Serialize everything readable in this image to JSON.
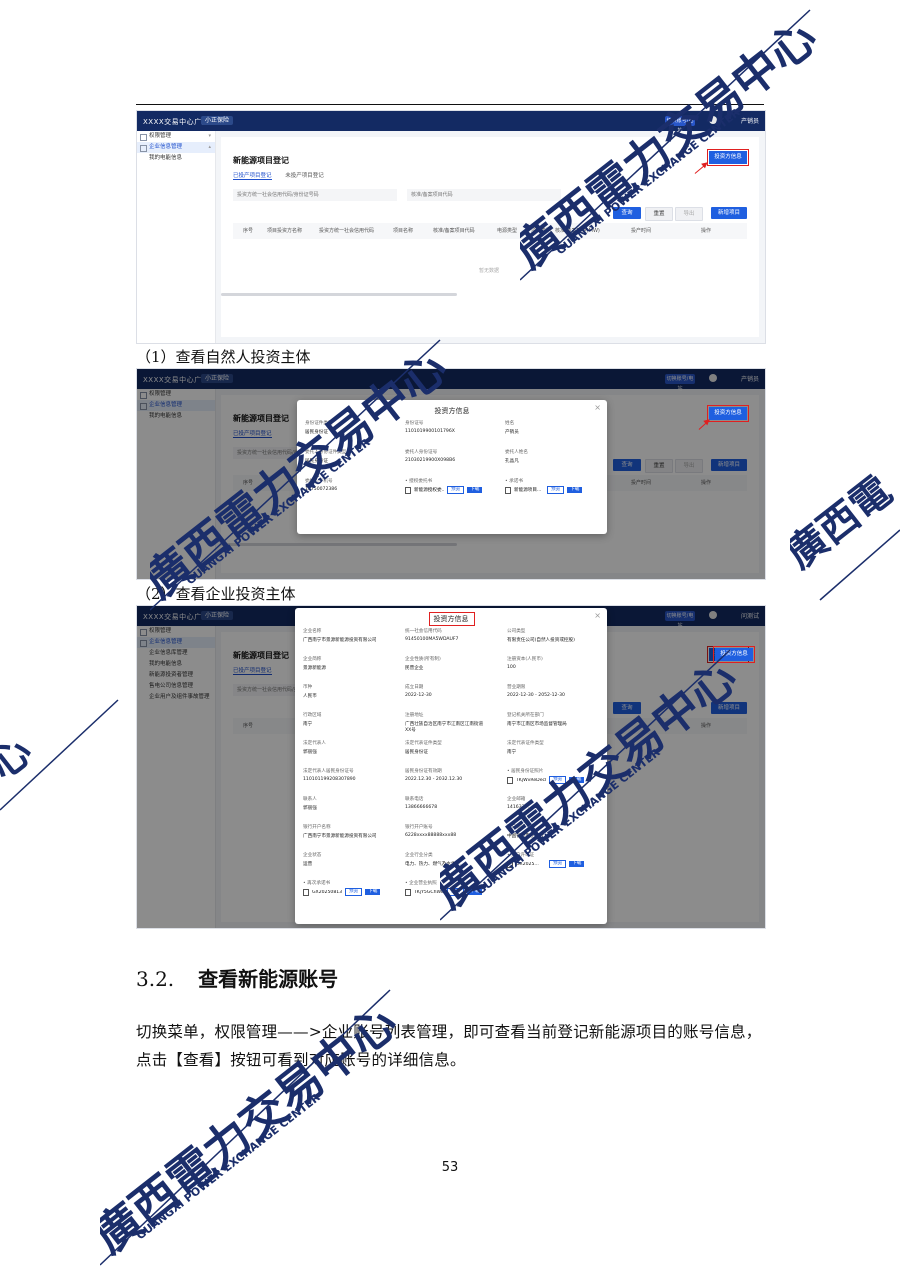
{
  "app": {
    "brand": "XXXX交易中心广西",
    "env_pill": "小正保险",
    "top_button": "切换账号/电站",
    "user": "产销员",
    "user2": "产销员",
    "user3": "问测试"
  },
  "sidebar": {
    "items": [
      "权限管理",
      "企业信息管理",
      "我的电能信息"
    ],
    "items3": [
      "权限管理",
      "企业信息管理",
      "企业信息库管理",
      "我的电能信息",
      "新能源投资者管理",
      "售电公司信息管理",
      "企业用户及组件事故管理"
    ]
  },
  "page": {
    "title": "新能源项目登记",
    "tabs": [
      "已投产项目登记",
      "未投产项目登记"
    ],
    "filter_id": "投资方统一社会信用代码/身份证号码",
    "filter_code": "核准/备案项目代码",
    "btn_query": "查询",
    "btn_reset": "重置",
    "btn_export": "导出",
    "btn_add": "新增项目",
    "btn_info": "投资方信息",
    "columns": [
      "序号",
      "项目投资方名称",
      "投资方统一社会信用代码",
      "项目名称",
      "核准/备案项目代码",
      "电源类型",
      "项目类别",
      "核准/备案容量(MW)",
      "投产时间",
      "操作"
    ],
    "empty": "暂无数据"
  },
  "captions": {
    "natural": "（1）查看自然人投资主体",
    "enterprise": "（2）查看企业投资主体"
  },
  "modal_natural": {
    "title": "投资方信息",
    "fields": [
      {
        "label": "身份证件类型",
        "value": "居民身份证"
      },
      {
        "label": "身份证号",
        "value": "1101019900101796X"
      },
      {
        "label": "姓名",
        "value": "产销员"
      },
      {
        "label": "委托人身份证件类型",
        "value": "居民身份证"
      },
      {
        "label": "委托人身份证号",
        "value": "21030219900X098B6"
      },
      {
        "label": "委托人姓名",
        "value": "孔晶凡"
      },
      {
        "label": "委托人手机号",
        "value": "13750072386"
      },
      {
        "label": "• 授权委托书",
        "value": "新能源授权委..."
      },
      {
        "label": "• 承诺书",
        "value": "新能源项目..."
      }
    ],
    "preview": "预览",
    "download": "下载"
  },
  "modal_enterprise": {
    "title": "投资方信息",
    "fields": [
      {
        "label": "企业名称",
        "value": "广西南宁市景源新能源投资有限公司"
      },
      {
        "label": "统一社会信用代码",
        "value": "91450100MA5WDAUF7"
      },
      {
        "label": "公司类型",
        "value": "有限责任公司(自然人投资或控股)"
      },
      {
        "label": "企业简称",
        "value": "景源新能源"
      },
      {
        "label": "企业性质(所有制)",
        "value": "民营企业"
      },
      {
        "label": "注册资本(人民币)",
        "value": "100"
      },
      {
        "label": "币种",
        "value": "人民币"
      },
      {
        "label": "成立日期",
        "value": "2022-12-30"
      },
      {
        "label": "营业期限",
        "value": "2022-12-30 - 2052-12-30"
      },
      {
        "label": "行政区域",
        "value": "南宁"
      },
      {
        "label": "注册地址",
        "value": "广西壮族自治区南宁市江南区江南街道XX号"
      },
      {
        "label": "登记机关所在部门",
        "value": "南宁市江南区市场监督管理局"
      },
      {
        "label": "法定代表人",
        "value": "郭丽强"
      },
      {
        "label": "法定代表证件类型",
        "value": "居民身份证"
      },
      {
        "label": "法定代表证件类型",
        "value": "南宁"
      },
      {
        "label": "法定代表人居民身份证号",
        "value": "110101199208307890"
      },
      {
        "label": "居民身份证有效期",
        "value": "2022.12.30 - 2032.12.30"
      },
      {
        "label": "• 居民身份证照片",
        "value": "TKjWvReDecM..."
      },
      {
        "label": "联系人",
        "value": "郭丽强"
      },
      {
        "label": "联系电话",
        "value": "13866666678"
      },
      {
        "label": "企业邮箱",
        "value": "1416337..."
      },
      {
        "label": "银行开户名称",
        "value": "广西南宁市景源新能源投资有限公司"
      },
      {
        "label": "银行开户账号",
        "value": "6228xxxx88888xxx88"
      },
      {
        "label": "开户银行",
        "value": "中国银行南宁支行"
      },
      {
        "label": "企业状态",
        "value": "运营"
      },
      {
        "label": "企业行业分类",
        "value": "电力、热力、燃气及水生产..."
      },
      {
        "label": "• 开户许可证",
        "value": "GX2025..."
      },
      {
        "label": "• 再次承诺书",
        "value": "GX2025081313..."
      },
      {
        "label": "• 企业营业执照",
        "value": "TKjY5GChWup..."
      }
    ],
    "preview": "预览",
    "download": "下载"
  },
  "section": {
    "number": "3.2.",
    "title": "查看新能源账号",
    "paragraph": "切换菜单，权限管理——>企业账号列表管理，即可查看当前登记新能源项目的账号信息，点击【查看】按钮可看到对应账号的详细信息。"
  },
  "page_number": "53",
  "seal": {
    "chinese": "廣西電力交易中心",
    "english": "GUANGXI POWER EXCHANGE CENTER"
  },
  "colors": {
    "topbar": "#132a63",
    "accent": "#1f5fe0",
    "highlight": "#e02020",
    "seal": "#1b2e6b"
  }
}
